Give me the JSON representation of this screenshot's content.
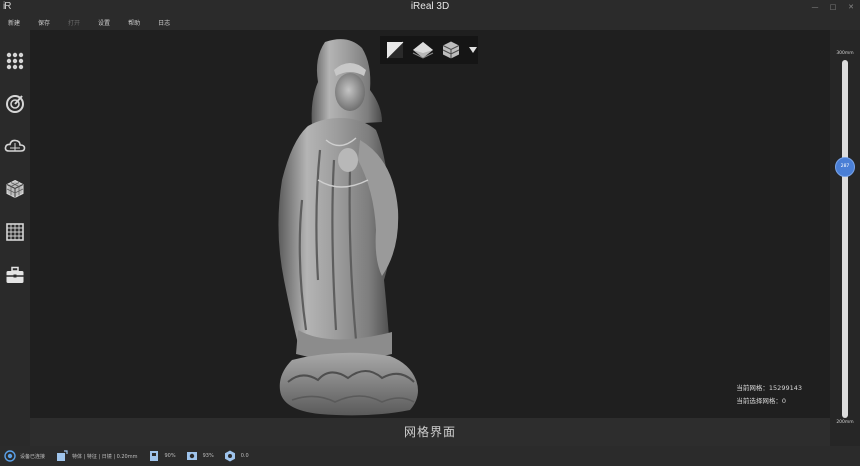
{
  "window": {
    "logo": "iR",
    "title": "iReal 3D",
    "minimize": "—",
    "maximize": "□",
    "close": "✕"
  },
  "menu": [
    "新建",
    "保存",
    "打开",
    "设置",
    "帮助",
    "日志"
  ],
  "menu_disabled_index": 2,
  "left_tools": [
    "grid-dots-icon",
    "scan-target-icon",
    "cloud-mesh-icon",
    "cube-mesh-icon",
    "grid-square-icon",
    "toolbox-icon"
  ],
  "view_toolbar": [
    "texture-toggle-icon",
    "layer-pyramid-icon",
    "layer-cube-icon",
    "chevron-down-icon"
  ],
  "stats": {
    "mesh_label": "当前网格：",
    "mesh_value": "15299143",
    "selected_label": "当前选择网格：",
    "selected_value": "0"
  },
  "view_label": "网格界面",
  "slider": {
    "max_label": "300mm",
    "min_label": "200mm",
    "value_label": "287",
    "value_fraction": 0.7,
    "accent": "#4a7fd6"
  },
  "status": {
    "device": "设备已连接",
    "mode": "特体 | 特征 | 日镜 | 0.20mm",
    "storage": "90%",
    "camera": "93%",
    "extra": "0.0"
  }
}
